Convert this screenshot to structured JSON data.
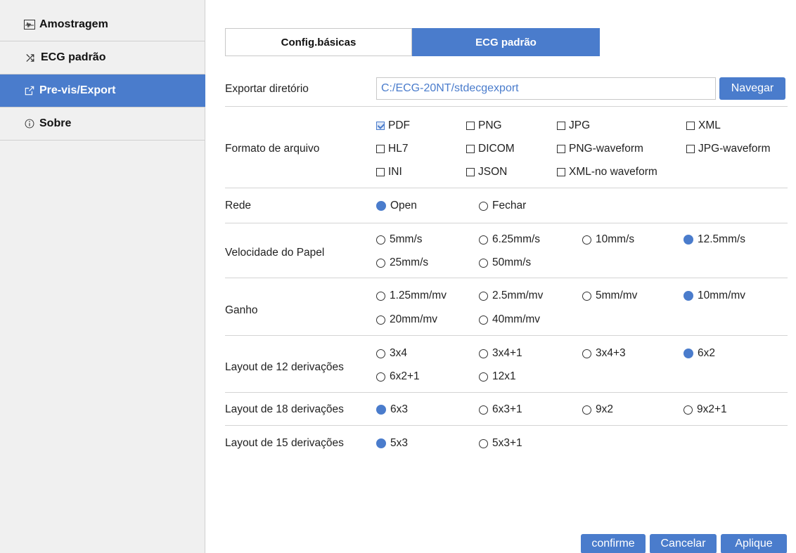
{
  "sidebar": {
    "items": [
      {
        "label": "Amostragem",
        "icon": "waveform-icon",
        "active": false
      },
      {
        "label": "ECG padrão",
        "icon": "shuffle-icon",
        "active": false
      },
      {
        "label": "Pre-vis/Export",
        "icon": "export-icon",
        "active": true
      },
      {
        "label": "Sobre",
        "icon": "info-icon",
        "active": false
      }
    ]
  },
  "tabs": [
    {
      "label": "Config.básicas",
      "active": false
    },
    {
      "label": "ECG padrão",
      "active": true
    }
  ],
  "export_dir": {
    "label": "Exportar diretório",
    "value": "C:/ECG-20NT/stdecgexport",
    "browse_label": "Navegar"
  },
  "file_format": {
    "label": "Formato de arquivo",
    "options": [
      {
        "label": "PDF",
        "checked": true
      },
      {
        "label": "PNG",
        "checked": false
      },
      {
        "label": "JPG",
        "checked": false
      },
      {
        "label": "XML",
        "checked": false
      },
      {
        "label": "HL7",
        "checked": false
      },
      {
        "label": "DICOM",
        "checked": false
      },
      {
        "label": "PNG-waveform",
        "checked": false
      },
      {
        "label": "JPG-waveform",
        "checked": false
      },
      {
        "label": "INI",
        "checked": false
      },
      {
        "label": "JSON",
        "checked": false
      },
      {
        "label": "XML-no waveform",
        "checked": false
      }
    ]
  },
  "network": {
    "label": "Rede",
    "options": [
      {
        "label": "Open",
        "selected": true
      },
      {
        "label": "Fechar",
        "selected": false
      }
    ]
  },
  "paper_speed": {
    "label": "Velocidade do Papel",
    "options": [
      {
        "label": "5mm/s",
        "selected": false
      },
      {
        "label": "6.25mm/s",
        "selected": false
      },
      {
        "label": "10mm/s",
        "selected": false
      },
      {
        "label": "12.5mm/s",
        "selected": true
      },
      {
        "label": "25mm/s",
        "selected": false
      },
      {
        "label": "50mm/s",
        "selected": false
      }
    ]
  },
  "gain": {
    "label": "Ganho",
    "options": [
      {
        "label": "1.25mm/mv",
        "selected": false
      },
      {
        "label": "2.5mm/mv",
        "selected": false
      },
      {
        "label": "5mm/mv",
        "selected": false
      },
      {
        "label": "10mm/mv",
        "selected": true
      },
      {
        "label": "20mm/mv",
        "selected": false
      },
      {
        "label": "40mm/mv",
        "selected": false
      }
    ]
  },
  "layout12": {
    "label": "Layout de 12 derivações",
    "options": [
      {
        "label": "3x4",
        "selected": false
      },
      {
        "label": "3x4+1",
        "selected": false
      },
      {
        "label": "3x4+3",
        "selected": false
      },
      {
        "label": "6x2",
        "selected": true
      },
      {
        "label": "6x2+1",
        "selected": false
      },
      {
        "label": "12x1",
        "selected": false
      }
    ]
  },
  "layout18": {
    "label": "Layout de 18 derivações",
    "options": [
      {
        "label": "6x3",
        "selected": true
      },
      {
        "label": "6x3+1",
        "selected": false
      },
      {
        "label": "9x2",
        "selected": false
      },
      {
        "label": "9x2+1",
        "selected": false
      }
    ]
  },
  "layout15": {
    "label": "Layout de 15 derivações",
    "options": [
      {
        "label": "5x3",
        "selected": true
      },
      {
        "label": "5x3+1",
        "selected": false
      }
    ]
  },
  "footer": {
    "confirm_label": "confirme",
    "cancel_label": "Cancelar",
    "apply_label": "Aplique"
  },
  "colors": {
    "accent": "#4a7ccc",
    "sidebar_bg": "#f0f0f0"
  }
}
